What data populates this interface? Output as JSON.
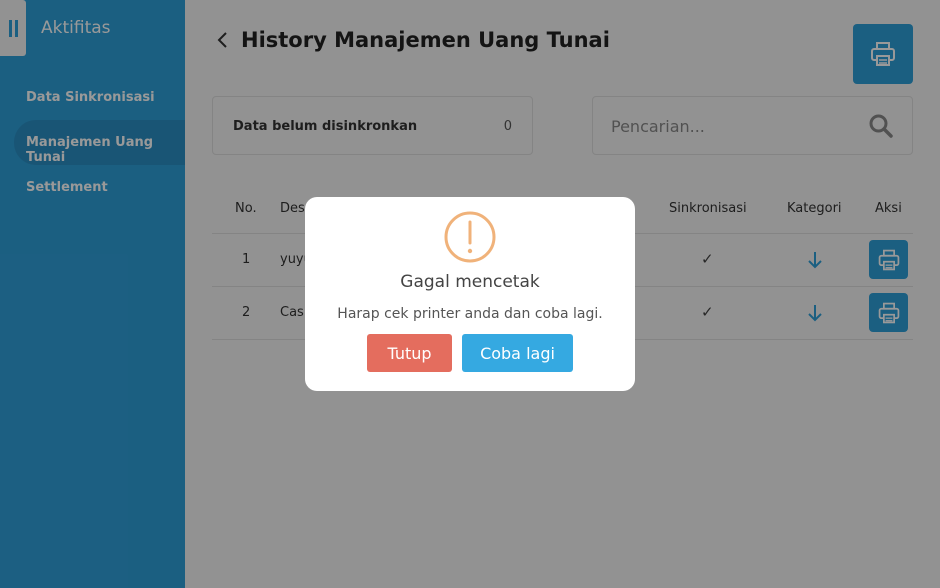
{
  "sidebar": {
    "title": "Aktifitas",
    "items": [
      {
        "label": "Data Sinkronisasi"
      },
      {
        "label": "Manajemen Uang Tunai"
      },
      {
        "label": "Settlement"
      }
    ]
  },
  "header": {
    "title": "History Manajemen Uang Tunai"
  },
  "unsynced": {
    "label": "Data belum disinkronkan",
    "count": "0"
  },
  "search": {
    "placeholder": "Pencarian..."
  },
  "table": {
    "columns": {
      "no": "No.",
      "desc": "Des",
      "sync": "Sinkronisasi",
      "category": "Kategori",
      "action": "Aksi"
    },
    "rows": [
      {
        "no": "1",
        "desc": "yuyu",
        "sync": "✓"
      },
      {
        "no": "2",
        "desc": "Cas",
        "sync": "✓"
      }
    ]
  },
  "dialog": {
    "title": "Gagal mencetak",
    "message": "Harap cek printer anda dan coba lagi.",
    "close_label": "Tutup",
    "retry_label": "Coba lagi"
  },
  "colors": {
    "primary": "#2e9fd8",
    "danger": "#e46d5e",
    "warning": "#f0b27a"
  }
}
